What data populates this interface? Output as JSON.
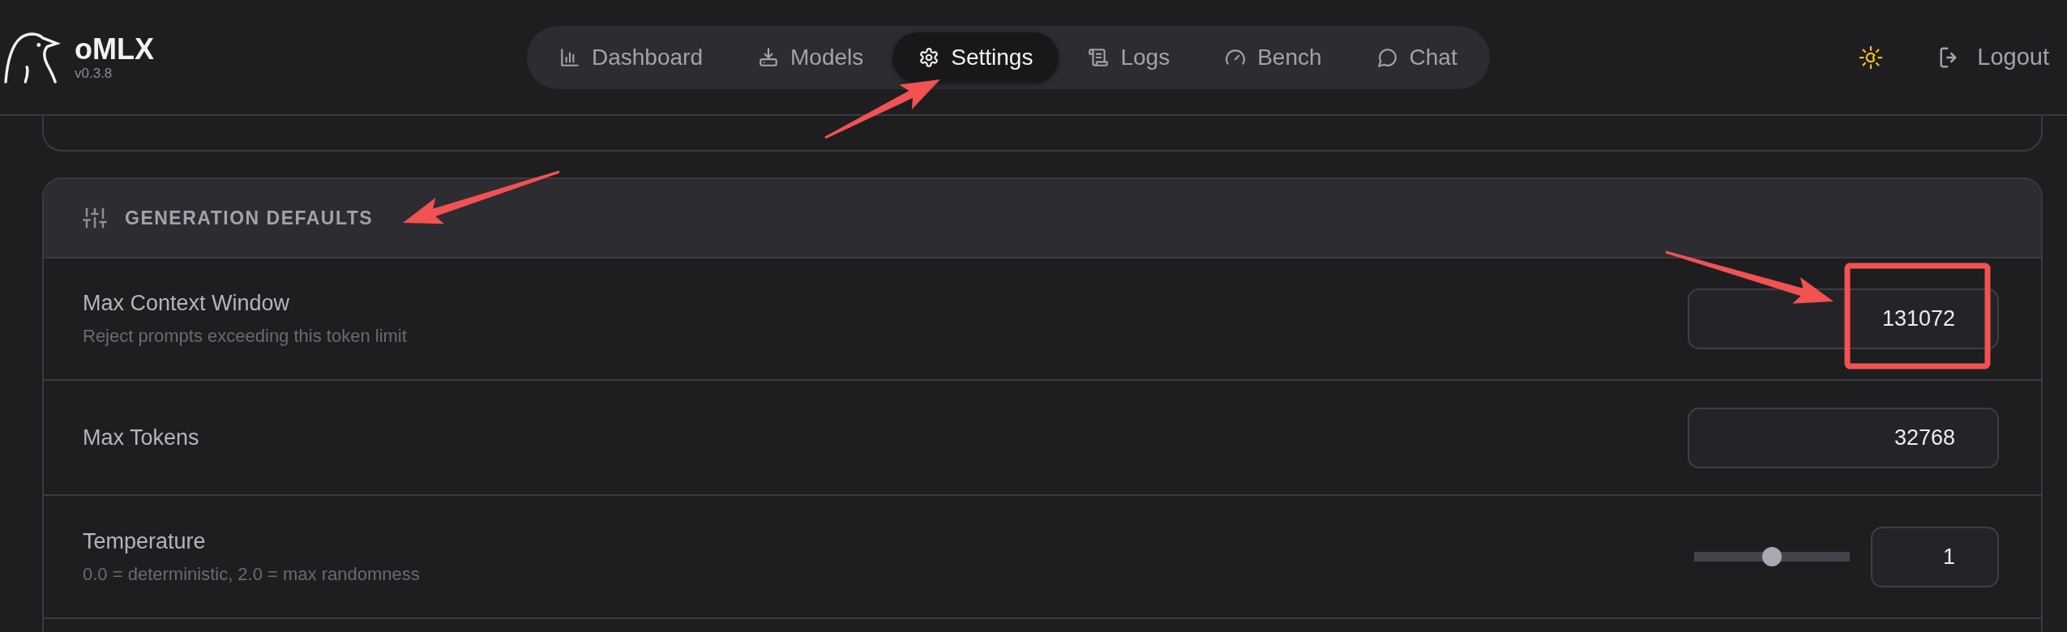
{
  "app": {
    "name": "oMLX",
    "version": "v0.3.8"
  },
  "nav": [
    {
      "label": "Dashboard",
      "selected": false
    },
    {
      "label": "Models",
      "selected": false
    },
    {
      "label": "Settings",
      "selected": true
    },
    {
      "label": "Logs",
      "selected": false
    },
    {
      "label": "Bench",
      "selected": false
    },
    {
      "label": "Chat",
      "selected": false
    }
  ],
  "logout": "Logout",
  "section": {
    "title": "GENERATION DEFAULTS",
    "settings": [
      {
        "kind": "number",
        "label": "Max Context Window",
        "description": "Reject prompts exceeding this token limit",
        "value": "131072"
      },
      {
        "kind": "number",
        "label": "Max Tokens",
        "value": "32768"
      },
      {
        "kind": "slider",
        "label": "Temperature",
        "description": "0.0 = deterministic, 2.0 = max randomness",
        "level": 0.5,
        "value": "1"
      }
    ]
  }
}
